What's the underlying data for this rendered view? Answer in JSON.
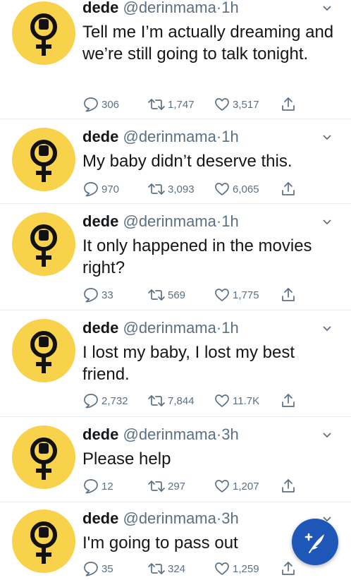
{
  "colors": {
    "avatar_bg": "#f7d24a",
    "accent": "#1f57b8",
    "muted": "#5b7083"
  },
  "icons": {
    "avatar": "female-symbol-fist-icon",
    "more": "chevron-down-icon",
    "reply": "reply-icon",
    "retweet": "retweet-icon",
    "like": "heart-icon",
    "share": "share-icon",
    "compose": "compose-tweet-icon"
  },
  "tweets": [
    {
      "name": "dede",
      "handle": "@derinmama",
      "dot": "·",
      "time": "1h",
      "text": "Tell me I’m actually dreaming and we’re still going to talk tonight.",
      "replies": "306",
      "retweets": "1,747",
      "likes": "3,517"
    },
    {
      "name": "dede",
      "handle": "@derinmama",
      "dot": "·",
      "time": "1h",
      "text": "My baby didn’t deserve this.",
      "replies": "970",
      "retweets": "3,093",
      "likes": "6,065"
    },
    {
      "name": "dede",
      "handle": "@derinmama",
      "dot": "·",
      "time": "1h",
      "text": "It only happened in the movies right?",
      "replies": "33",
      "retweets": "569",
      "likes": "1,775"
    },
    {
      "name": "dede",
      "handle": "@derinmama",
      "dot": "·",
      "time": "1h",
      "text": "I lost my baby, I lost my best friend.",
      "replies": "2,732",
      "retweets": "7,844",
      "likes": "11.7K"
    },
    {
      "name": "dede",
      "handle": "@derinmama",
      "dot": "·",
      "time": "3h",
      "text": "Please help",
      "replies": "12",
      "retweets": "297",
      "likes": "1,207"
    },
    {
      "name": "dede",
      "handle": "@derinmama",
      "dot": "·",
      "time": "3h",
      "text": "I'm going to pass out",
      "replies": "35",
      "retweets": "324",
      "likes": "1,259"
    }
  ]
}
